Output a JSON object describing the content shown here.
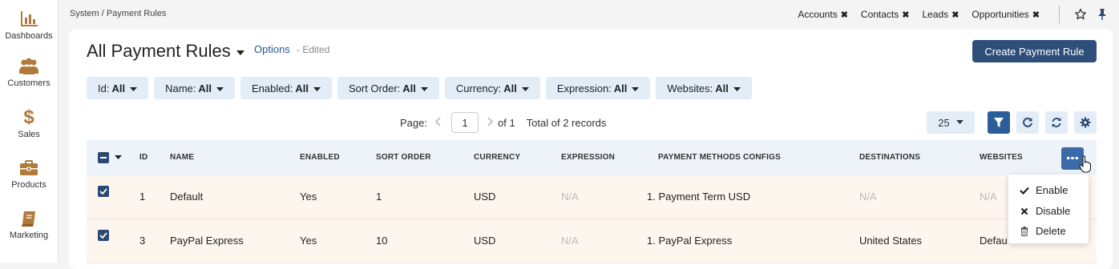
{
  "sidebar": {
    "items": [
      {
        "label": "Dashboards",
        "icon": "bar-chart-icon"
      },
      {
        "label": "Customers",
        "icon": "users-icon"
      },
      {
        "label": "Sales",
        "icon": "dollar-icon"
      },
      {
        "label": "Products",
        "icon": "briefcase-icon"
      },
      {
        "label": "Marketing",
        "icon": "book-icon"
      }
    ],
    "icon_color": "#b07a3a"
  },
  "breadcrumb": "System / Payment Rules",
  "quick_links": [
    "Accounts",
    "Contacts",
    "Leads",
    "Opportunities"
  ],
  "quick_link_close": "✖",
  "header": {
    "title": "All Payment Rules",
    "options_label": "Options",
    "edited_label": "- Edited",
    "create_button": "Create Payment Rule"
  },
  "filters": [
    {
      "name": "Id:",
      "value": "All"
    },
    {
      "name": "Name:",
      "value": "All"
    },
    {
      "name": "Enabled:",
      "value": "All"
    },
    {
      "name": "Sort Order:",
      "value": "All"
    },
    {
      "name": "Currency:",
      "value": "All"
    },
    {
      "name": "Expression:",
      "value": "All"
    },
    {
      "name": "Websites:",
      "value": "All"
    }
  ],
  "pager": {
    "page_label": "Page:",
    "current_page": "1",
    "of_label": "of 1",
    "total_label": "Total of 2 records",
    "per_page": "25"
  },
  "table": {
    "columns": [
      "ID",
      "NAME",
      "ENABLED",
      "SORT ORDER",
      "CURRENCY",
      "EXPRESSION",
      "PAYMENT METHODS CONFIGS",
      "DESTINATIONS",
      "WEBSITES"
    ],
    "rows": [
      {
        "id": "1",
        "name": "Default",
        "enabled": "Yes",
        "sort_order": "1",
        "currency": "USD",
        "expression": "N/A",
        "payment_methods": "1. Payment Term USD",
        "destinations": "N/A",
        "websites": "N/A"
      },
      {
        "id": "3",
        "name": "PayPal Express",
        "enabled": "Yes",
        "sort_order": "10",
        "currency": "USD",
        "expression": "N/A",
        "payment_methods": "1. PayPal Express",
        "destinations": "United States",
        "websites": "Defau"
      }
    ]
  },
  "mass_actions": [
    {
      "label": "Enable",
      "icon": "check-icon"
    },
    {
      "label": "Disable",
      "icon": "x-icon"
    },
    {
      "label": "Delete",
      "icon": "trash-icon"
    }
  ],
  "colors": {
    "primary": "#2d4f79",
    "filter_bg": "#e3edf8",
    "row_bg": "#fdf6ee",
    "link": "#2b5799"
  }
}
